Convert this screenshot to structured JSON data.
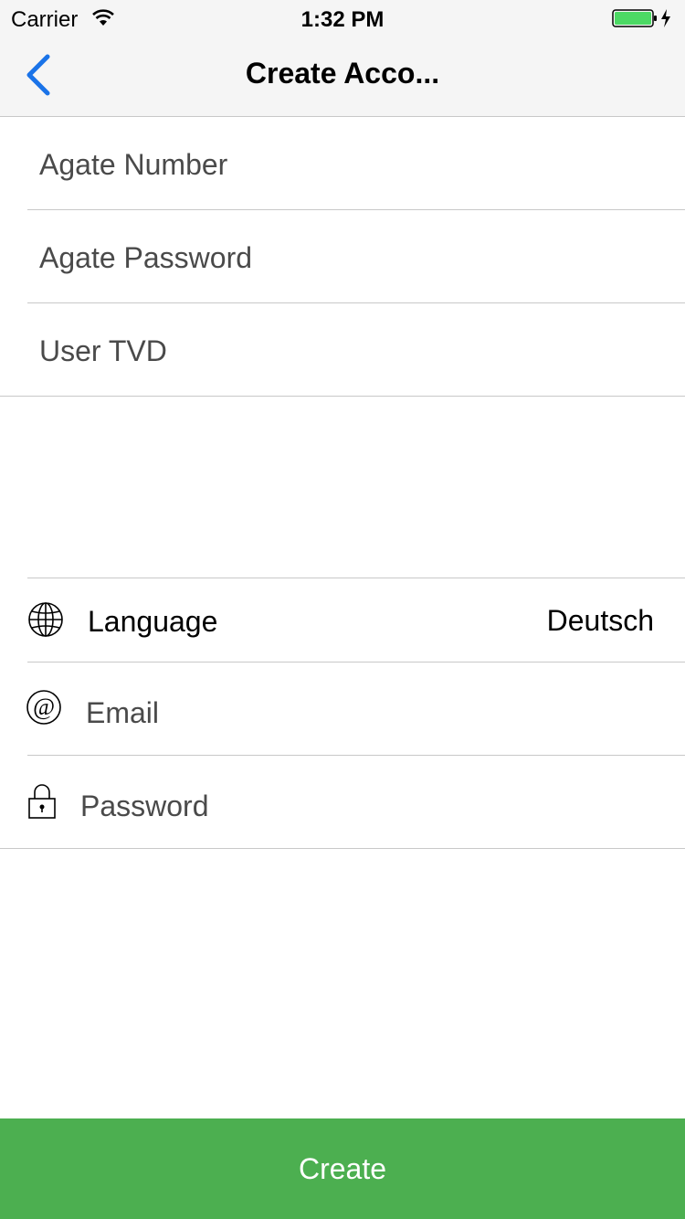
{
  "status_bar": {
    "carrier": "Carrier",
    "time": "1:32 PM",
    "battery_color": "#4cd964"
  },
  "nav": {
    "title": "Create Acco...",
    "back_icon": "chevron-left-icon",
    "accent_color": "#1a73e8"
  },
  "agate_section": {
    "number_placeholder": "Agate Number",
    "password_placeholder": "Agate Password",
    "user_tvd_placeholder": "User TVD"
  },
  "account_section": {
    "language_icon": "globe-icon",
    "language_label": "Language",
    "language_value": "Deutsch",
    "email_icon": "at-icon",
    "email_placeholder": "Email",
    "password_icon": "lock-icon",
    "password_placeholder": "Password"
  },
  "create_button": {
    "label": "Create",
    "color": "#4caf50"
  }
}
